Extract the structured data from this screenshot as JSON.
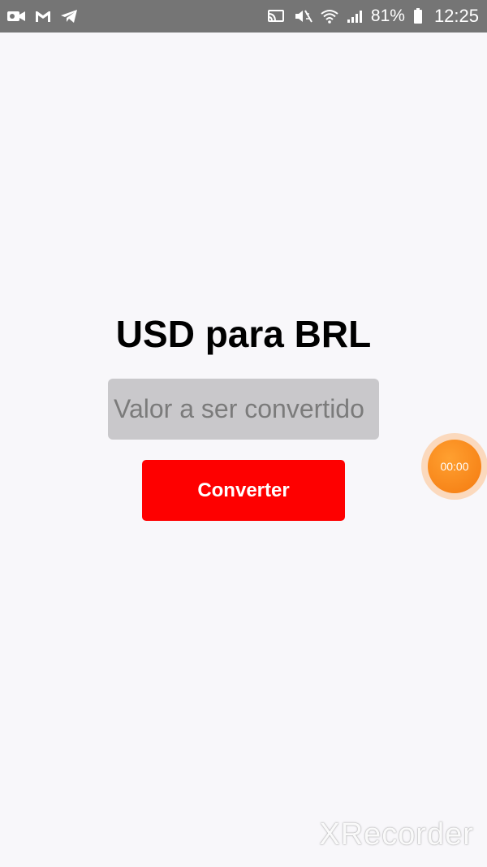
{
  "status_bar": {
    "left_icons": [
      "video-camera-icon",
      "gmail-icon",
      "telegram-icon"
    ],
    "right_icons": [
      "cast-icon",
      "mute-icon",
      "wifi-icon",
      "signal-icon"
    ],
    "battery_percent": "81%",
    "time": "12:25"
  },
  "main": {
    "title": "USD para BRL",
    "input": {
      "placeholder": "Valor a ser convertido",
      "value": ""
    },
    "convert_button_label": "Converter"
  },
  "recorder_bubble": {
    "timer": "00:00"
  },
  "watermark": "XRecorder",
  "colors": {
    "status_bar_bg": "#757575",
    "background": "#f8f7fa",
    "input_bg": "#c9c8cb",
    "button_bg": "#fe0000",
    "bubble": "#f47a10"
  }
}
